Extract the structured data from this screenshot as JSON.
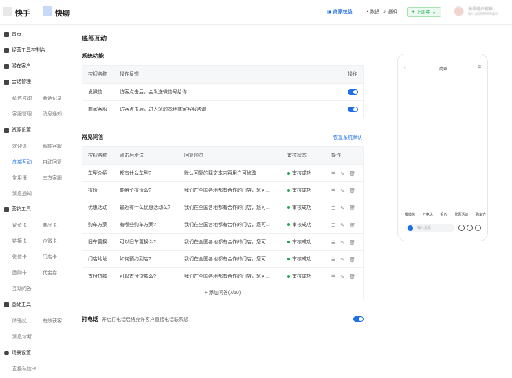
{
  "header": {
    "brand1": "快手",
    "brand2": "快聊",
    "merchant_link": "商家权益",
    "data": "数据",
    "notice": "通知",
    "status": "上班中",
    "user_name": "快手用户昵称...",
    "user_id": "ID: 1020000010"
  },
  "sidebar": {
    "home": "首页",
    "console": "经营工具控制台",
    "potential": "潜在客户",
    "session": "会话管理",
    "session_items": [
      "私信咨询",
      "会话记录",
      "客服管理",
      "消息通知"
    ],
    "assets": "资源设置",
    "asset_items": [
      "欢迎语",
      "智能客服",
      "底部互动",
      "自动回复",
      "常用语",
      "三方客服",
      "消息通知"
    ],
    "marketing": "营销工具",
    "marketing_items": [
      "留资卡",
      "商品卡",
      "链接卡",
      "企微卡",
      "微信卡",
      "门店卡",
      "团购卡",
      "代金券",
      "互动问答"
    ],
    "basic": "基础工具",
    "basic_items": [
      "防骚扰",
      "有效获客",
      "消息诊断"
    ],
    "scene": "场景设置",
    "scene_items": [
      "直播私信卡"
    ]
  },
  "main": {
    "title": "底部互动",
    "system_title": "系统功能",
    "system_headers": [
      "按钮名称",
      "操作反馈",
      "操作"
    ],
    "system_rows": [
      {
        "name": "发微信",
        "desc": "访客点击后，会发送微信号给你"
      },
      {
        "name": "商家客服",
        "desc": "访客点击后，进入您的本地商家客服咨询"
      }
    ],
    "faq_title": "常见问答",
    "restore": "恢复系统默认",
    "faq_headers": [
      "按钮名称",
      "点击后发送",
      "回复预览",
      "审核状态",
      "操作"
    ],
    "faq_rows": [
      {
        "name": "车型介绍",
        "send": "都有什么车型?",
        "reply": "默认回复的释文本内容用户可修改",
        "status": "审核成功"
      },
      {
        "name": "报价",
        "send": "能给个报价么?",
        "reply": "我们在全国各地都有合作的门店，您可...",
        "status": "审核成功"
      },
      {
        "name": "优惠活动",
        "send": "最近有什么优惠活动么?",
        "reply": "我们在全国各地都有合作的门店，您可...",
        "status": "审核成功"
      },
      {
        "name": "购车方案",
        "send": "有哪些购车方案?",
        "reply": "我们在全国各地都有合作的门店，您可...",
        "status": "审核成功"
      },
      {
        "name": "旧车置换",
        "send": "可以旧车置换么?",
        "reply": "我们在全国各地都有合作的门店，您可...",
        "status": "审核成功"
      },
      {
        "name": "门店地址",
        "send": "如何预约到店?",
        "reply": "我们在全国各地都有合作的门店，您可...",
        "status": "审核成功"
      },
      {
        "name": "首付贷款",
        "send": "可以首付贷款么?",
        "reply": "我们在全国各地都有合作的门店，您可...",
        "status": "审核成功"
      }
    ],
    "add_label": "+ 添加问答(7/10)",
    "phone_title": "打电话",
    "phone_desc": "开启打电话后将允许客户直接电话联系您"
  },
  "preview": {
    "title": "商家",
    "actions": [
      "发微信",
      "打电话",
      "报价",
      "优惠活动",
      "购车方"
    ],
    "input_placeholder": "输入消息"
  }
}
